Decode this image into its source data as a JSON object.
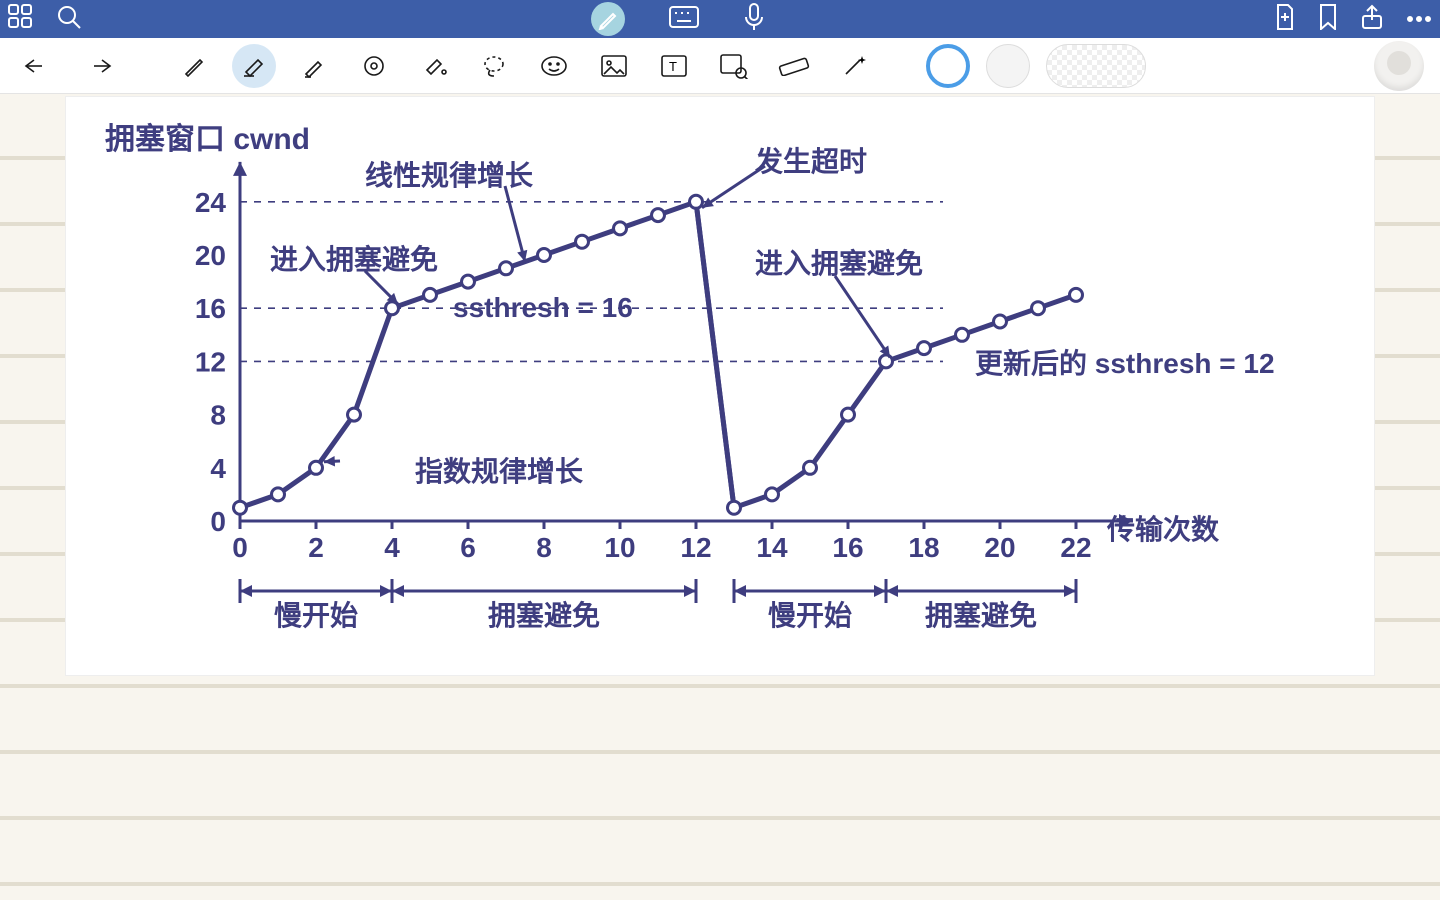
{
  "header": {
    "icons": [
      "apps-icon",
      "search-icon",
      "pen-icon",
      "keyboard-icon",
      "mic-icon",
      "new-page-icon",
      "bookmark-icon",
      "share-icon",
      "more-icon"
    ]
  },
  "toolbar": {
    "tools": [
      "undo",
      "redo",
      "pen",
      "eraser",
      "highlighter",
      "shape",
      "fill",
      "lasso",
      "sticker",
      "image",
      "text",
      "image-search",
      "ruler",
      "magic"
    ],
    "active_tool": "eraser"
  },
  "chart_data": {
    "type": "line",
    "title": "",
    "ylabel": "拥塞窗口 cwnd",
    "xlabel": "传输次数",
    "xlim": [
      0,
      22
    ],
    "ylim": [
      0,
      24
    ],
    "yticks": [
      0,
      4,
      8,
      12,
      16,
      20,
      24
    ],
    "xticks": [
      0,
      2,
      4,
      6,
      8,
      10,
      12,
      14,
      16,
      18,
      20,
      22
    ],
    "gridlines_y": [
      12,
      16,
      24
    ],
    "series": [
      {
        "name": "cwnd",
        "x": [
          0,
          1,
          2,
          3,
          4,
          5,
          6,
          7,
          8,
          9,
          10,
          11,
          12,
          13,
          14,
          15,
          16,
          17,
          18,
          19,
          20,
          21,
          22
        ],
        "y": [
          1,
          2,
          4,
          8,
          16,
          17,
          18,
          19,
          20,
          21,
          22,
          23,
          24,
          1,
          2,
          4,
          8,
          12,
          13,
          14,
          15,
          16,
          17
        ]
      }
    ],
    "annotations": {
      "linear_growth": "线性规律增长",
      "timeout": "发生超时",
      "enter_avoid_1": "进入拥塞避免",
      "ssthresh_1": "ssthresh = 16",
      "exp_growth": "指数规律增长",
      "enter_avoid_2": "进入拥塞避免",
      "ssthresh_2": "更新后的 ssthresh = 12"
    },
    "phases": {
      "slow_start": "慢开始",
      "congestion_avoidance": "拥塞避免"
    },
    "phase_ranges": [
      {
        "label_key": "slow_start",
        "from": 0,
        "to": 4
      },
      {
        "label_key": "congestion_avoidance",
        "from": 4,
        "to": 12
      },
      {
        "label_key": "slow_start",
        "from": 13,
        "to": 17
      },
      {
        "label_key": "congestion_avoidance",
        "from": 17,
        "to": 22
      }
    ]
  },
  "colors": {
    "axis": "#3e3d7f",
    "point_fill": "#ffffff"
  }
}
